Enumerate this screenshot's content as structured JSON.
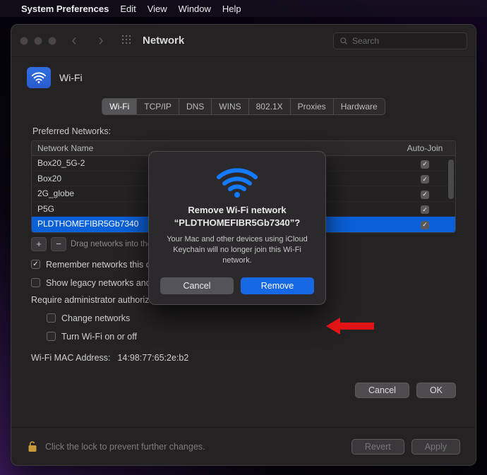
{
  "menubar": {
    "appname": "System Preferences",
    "items": [
      "Edit",
      "View",
      "Window",
      "Help"
    ]
  },
  "titlebar": {
    "title": "Network",
    "search_placeholder": "Search"
  },
  "wifi_header": {
    "label": "Wi-Fi"
  },
  "tabs": [
    "Wi-Fi",
    "TCP/IP",
    "DNS",
    "WINS",
    "802.1X",
    "Proxies",
    "Hardware"
  ],
  "section": {
    "preferred_label": "Preferred Networks:",
    "col_name": "Network Name",
    "col_auto": "Auto-Join"
  },
  "networks": [
    {
      "name": "Box20_5G-2",
      "autojoin": true
    },
    {
      "name": "Box20",
      "autojoin": true
    },
    {
      "name": "2G_globe",
      "autojoin": true
    },
    {
      "name": "P5G",
      "autojoin": true
    },
    {
      "name": "PLDTHOMEFIBR5Gb7340",
      "autojoin": true,
      "selected": true
    }
  ],
  "under_table": {
    "drag_hint": "Drag networks into the order you prefer."
  },
  "checks": {
    "remember": "Remember networks this computer has joined",
    "legacy": "Show legacy networks and options",
    "admin_label": "Require administrator authorization to:",
    "change": "Change networks",
    "toggle_wifi": "Turn Wi-Fi on or off"
  },
  "mac": {
    "label": "Wi-Fi MAC Address:",
    "value": "14:98:77:65:2e:b2"
  },
  "bottom": {
    "cancel": "Cancel",
    "ok": "OK"
  },
  "footer": {
    "text": "Click the lock to prevent further changes.",
    "revert": "Revert",
    "apply": "Apply"
  },
  "dialog": {
    "title_line1": "Remove Wi-Fi network",
    "title_line2": "“PLDTHOMEFIBR5Gb7340”?",
    "body": "Your Mac and other devices using iCloud Keychain will no longer join this Wi-Fi network.",
    "cancel": "Cancel",
    "remove": "Remove"
  }
}
